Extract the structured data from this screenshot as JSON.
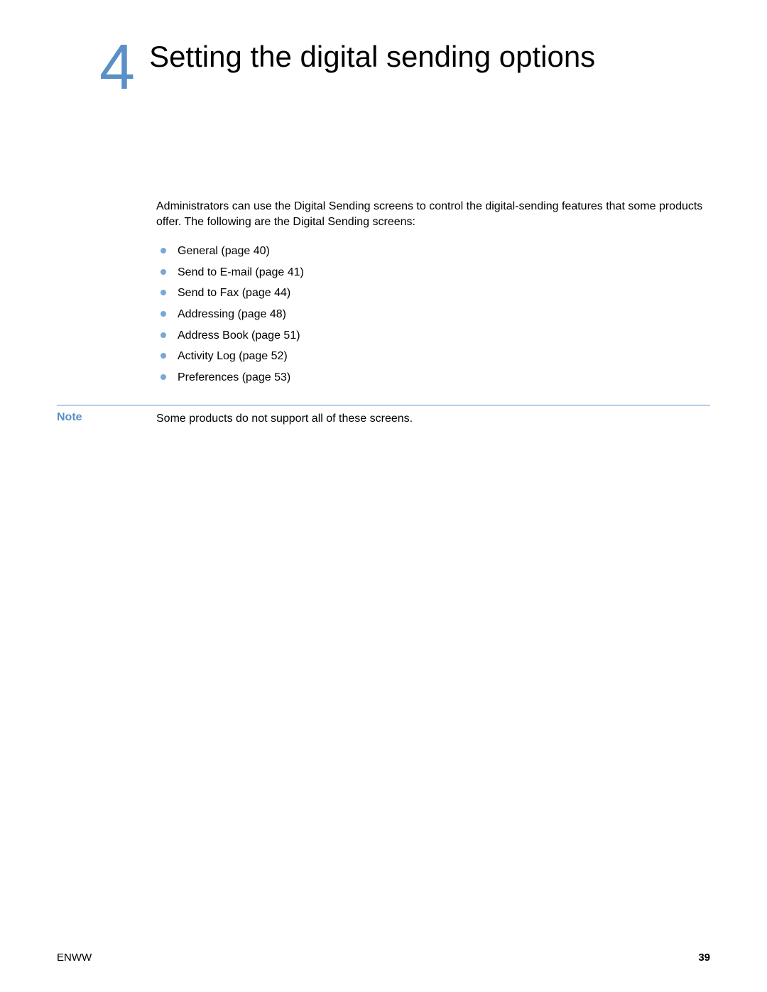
{
  "chapter": {
    "number": "4",
    "title": "Setting the digital sending options"
  },
  "intro": "Administrators can use the Digital Sending screens to control the digital-sending features that some products offer. The following are the Digital Sending screens:",
  "bullets": [
    "General (page 40)",
    "Send to E-mail (page 41)",
    "Send to Fax (page 44)",
    "Addressing (page 48)",
    "Address Book (page 51)",
    "Activity Log (page 52)",
    "Preferences (page 53)"
  ],
  "note": {
    "label": "Note",
    "text": "Some products do not support all of these screens."
  },
  "footer": {
    "left": "ENWW",
    "right": "39"
  },
  "colors": {
    "accent": "#5a8fc7",
    "bullet": "#7aa8d4"
  }
}
